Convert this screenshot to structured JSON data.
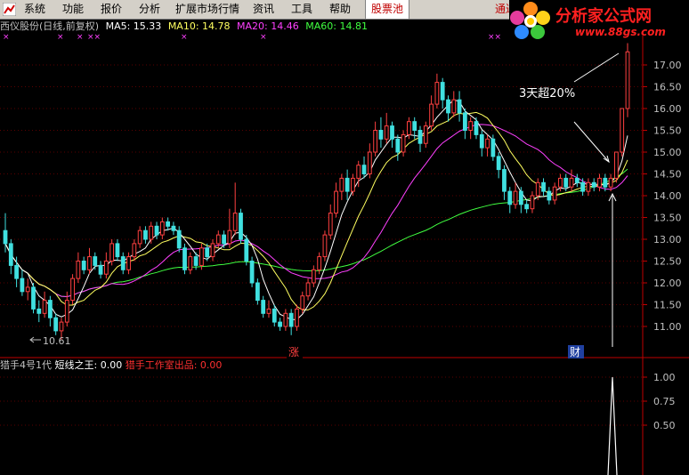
{
  "menu": {
    "items": [
      "系统",
      "功能",
      "报价",
      "分析",
      "扩展市场行情",
      "资讯",
      "工具",
      "帮助"
    ],
    "highlight": "股票池",
    "right": "通达"
  },
  "logo": {
    "title": "分析家公式网",
    "url": "www.88gs.com"
  },
  "info": {
    "title": "西仪股份(日线,前复权)",
    "ma5": "MA5: 15.33",
    "ma10": "MA10: 14.78",
    "ma20": "MA20: 14.46",
    "ma60": "MA60: 14.81"
  },
  "colors": {
    "up": "#ff4040",
    "down": "#40e0e0",
    "ma5": "#ffffff",
    "ma10": "#ffff60",
    "ma20": "#ff40ff",
    "ma60": "#40ff40",
    "axis": "#c00000"
  },
  "annotations": {
    "low_price": "10.61",
    "callout": "3天超20%",
    "marker_zhang": "涨",
    "marker_cai": "财"
  },
  "indicator": {
    "name": "猎手4号1代",
    "field1": "短线之王: 0.00",
    "field2": "猎手工作室出品: 0.00",
    "y_ticks": [
      "1.00",
      "0.75",
      "0.50"
    ]
  },
  "chart_data": {
    "type": "candlestick",
    "y_ticks": [
      "17.00",
      "16.50",
      "16.00",
      "15.50",
      "15.00",
      "14.50",
      "14.00",
      "13.50",
      "13.00",
      "12.50",
      "12.00",
      "11.50",
      "11.00"
    ],
    "ylim": [
      10.6,
      17.6
    ],
    "candles": [
      [
        13.2,
        12.9,
        13.6,
        12.7
      ],
      [
        12.9,
        12.4,
        13.0,
        12.2
      ],
      [
        12.4,
        12.1,
        12.6,
        11.9
      ],
      [
        12.1,
        11.8,
        12.3,
        11.7
      ],
      [
        11.8,
        11.9,
        12.1,
        11.6
      ],
      [
        11.9,
        11.4,
        12.0,
        11.3
      ],
      [
        11.4,
        11.3,
        11.6,
        11.1
      ],
      [
        11.3,
        11.6,
        11.8,
        11.2
      ],
      [
        11.6,
        11.2,
        11.7,
        11.0
      ],
      [
        11.2,
        10.9,
        11.3,
        10.8
      ],
      [
        10.9,
        11.1,
        11.2,
        10.7
      ],
      [
        11.1,
        11.6,
        11.8,
        11.0
      ],
      [
        11.6,
        12.1,
        12.2,
        11.5
      ],
      [
        12.1,
        12.5,
        12.7,
        12.0
      ],
      [
        12.5,
        12.3,
        12.6,
        12.2
      ],
      [
        12.3,
        12.6,
        12.8,
        12.2
      ],
      [
        12.6,
        12.4,
        12.7,
        12.3
      ],
      [
        12.4,
        12.2,
        12.5,
        12.1
      ],
      [
        12.2,
        12.5,
        12.7,
        12.1
      ],
      [
        12.5,
        12.9,
        13.0,
        12.4
      ],
      [
        12.9,
        12.6,
        13.0,
        12.5
      ],
      [
        12.6,
        12.3,
        12.7,
        12.2
      ],
      [
        12.3,
        12.6,
        12.7,
        12.2
      ],
      [
        12.6,
        12.9,
        13.0,
        12.5
      ],
      [
        12.9,
        13.2,
        13.3,
        12.8
      ],
      [
        13.2,
        13.0,
        13.3,
        12.9
      ],
      [
        13.0,
        13.3,
        13.4,
        12.9
      ],
      [
        13.3,
        13.1,
        13.4,
        13.0
      ],
      [
        13.1,
        13.4,
        13.5,
        13.0
      ],
      [
        13.4,
        13.3,
        13.5,
        13.2
      ],
      [
        13.3,
        13.2,
        13.4,
        13.1
      ],
      [
        13.2,
        12.8,
        13.3,
        12.7
      ],
      [
        12.8,
        12.3,
        12.9,
        12.2
      ],
      [
        12.3,
        12.6,
        12.7,
        12.2
      ],
      [
        12.6,
        12.4,
        12.7,
        12.3
      ],
      [
        12.4,
        12.8,
        12.9,
        12.3
      ],
      [
        12.8,
        12.6,
        12.9,
        12.5
      ],
      [
        12.6,
        12.9,
        13.0,
        12.5
      ],
      [
        12.9,
        13.1,
        13.2,
        12.8
      ],
      [
        13.1,
        12.9,
        13.2,
        12.8
      ],
      [
        12.9,
        13.2,
        13.7,
        12.8
      ],
      [
        13.2,
        13.6,
        14.3,
        13.1
      ],
      [
        13.6,
        13.0,
        13.7,
        12.9
      ],
      [
        13.0,
        12.5,
        13.1,
        12.4
      ],
      [
        12.5,
        12.0,
        12.6,
        11.9
      ],
      [
        12.0,
        11.6,
        12.1,
        11.5
      ],
      [
        11.6,
        11.3,
        11.7,
        11.2
      ],
      [
        11.3,
        11.4,
        11.6,
        11.2
      ],
      [
        11.4,
        11.1,
        11.5,
        11.0
      ],
      [
        11.1,
        11.0,
        11.2,
        10.9
      ],
      [
        11.0,
        11.3,
        11.4,
        10.9
      ],
      [
        11.3,
        11.0,
        11.4,
        10.8
      ],
      [
        11.0,
        11.4,
        11.5,
        10.9
      ],
      [
        11.4,
        11.7,
        11.8,
        11.3
      ],
      [
        11.7,
        12.0,
        12.1,
        11.6
      ],
      [
        12.0,
        12.3,
        12.4,
        11.9
      ],
      [
        12.3,
        12.6,
        12.7,
        12.2
      ],
      [
        12.6,
        13.1,
        13.2,
        12.5
      ],
      [
        13.1,
        13.6,
        13.8,
        13.0
      ],
      [
        13.6,
        14.1,
        14.3,
        13.5
      ],
      [
        14.1,
        14.4,
        14.5,
        13.9
      ],
      [
        14.4,
        14.1,
        14.6,
        13.9
      ],
      [
        14.1,
        14.4,
        14.5,
        14.0
      ],
      [
        14.4,
        14.7,
        14.8,
        14.2
      ],
      [
        14.7,
        14.5,
        14.9,
        14.4
      ],
      [
        14.5,
        15.0,
        15.2,
        14.4
      ],
      [
        15.0,
        15.5,
        15.7,
        14.9
      ],
      [
        15.5,
        15.3,
        15.8,
        15.1
      ],
      [
        15.3,
        15.6,
        15.9,
        15.2
      ],
      [
        15.6,
        15.3,
        15.7,
        15.1
      ],
      [
        15.3,
        15.0,
        15.4,
        14.8
      ],
      [
        15.0,
        15.4,
        15.5,
        14.9
      ],
      [
        15.4,
        15.7,
        15.8,
        15.3
      ],
      [
        15.7,
        15.5,
        15.8,
        15.3
      ],
      [
        15.5,
        15.2,
        15.6,
        15.0
      ],
      [
        15.2,
        15.6,
        15.7,
        15.1
      ],
      [
        15.6,
        16.1,
        16.3,
        15.5
      ],
      [
        16.1,
        16.6,
        16.8,
        16.0
      ],
      [
        16.6,
        16.2,
        16.7,
        16.0
      ],
      [
        16.2,
        15.9,
        16.3,
        15.7
      ],
      [
        15.9,
        16.2,
        16.4,
        15.8
      ],
      [
        16.2,
        15.9,
        16.4,
        15.7
      ],
      [
        15.9,
        15.5,
        16.0,
        15.3
      ],
      [
        15.5,
        15.7,
        15.8,
        15.3
      ],
      [
        15.7,
        15.4,
        15.8,
        15.3
      ],
      [
        15.4,
        15.1,
        15.5,
        14.9
      ],
      [
        15.1,
        15.3,
        15.4,
        14.9
      ],
      [
        15.3,
        14.9,
        15.4,
        14.8
      ],
      [
        14.9,
        14.6,
        15.0,
        14.4
      ],
      [
        14.6,
        14.1,
        14.7,
        13.9
      ],
      [
        14.1,
        13.8,
        14.2,
        13.6
      ],
      [
        13.8,
        14.1,
        14.3,
        13.7
      ],
      [
        14.1,
        13.8,
        14.2,
        13.6
      ],
      [
        13.8,
        13.7,
        13.9,
        13.6
      ],
      [
        13.7,
        14.0,
        14.1,
        13.6
      ],
      [
        14.0,
        14.3,
        14.4,
        13.9
      ],
      [
        14.3,
        14.1,
        14.4,
        14.0
      ],
      [
        14.1,
        13.9,
        14.2,
        13.8
      ],
      [
        13.9,
        14.2,
        14.3,
        13.8
      ],
      [
        14.2,
        14.4,
        14.5,
        14.1
      ],
      [
        14.4,
        14.2,
        14.5,
        14.1
      ],
      [
        14.2,
        14.4,
        14.6,
        14.1
      ],
      [
        14.4,
        14.3,
        14.5,
        14.2
      ],
      [
        14.3,
        14.1,
        14.4,
        14.0
      ],
      [
        14.1,
        14.3,
        14.4,
        14.0
      ],
      [
        14.3,
        14.2,
        14.4,
        14.1
      ],
      [
        14.2,
        14.4,
        14.5,
        14.1
      ],
      [
        14.4,
        14.2,
        14.5,
        14.1
      ],
      [
        14.2,
        14.4,
        14.5,
        14.1
      ],
      [
        14.4,
        15.0,
        15.0,
        14.3
      ],
      [
        15.0,
        16.0,
        16.0,
        14.9
      ],
      [
        16.0,
        17.3,
        17.5,
        15.8
      ]
    ]
  }
}
